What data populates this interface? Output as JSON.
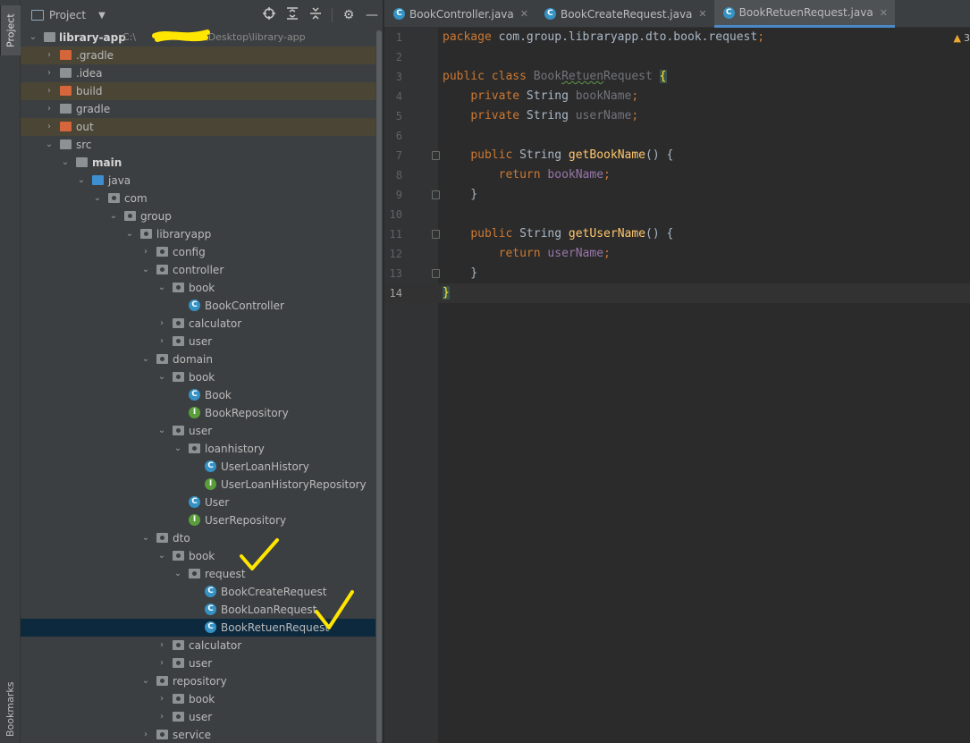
{
  "toolstrip": {
    "project_label": "Project",
    "bookmarks_label": "Bookmarks"
  },
  "project_panel": {
    "title": "Project",
    "tools": [
      "crosshair-icon",
      "expand-icon",
      "collapse-icon",
      "gear-icon",
      "minimize-icon"
    ],
    "root": {
      "name": "library-app",
      "path_prefix": "C:\\",
      "path_suffix": "\\Desktop\\library-app"
    },
    "nodes": [
      {
        "label": ".gradle",
        "icon": "folder-orange",
        "excluded": true,
        "collapsed": true
      },
      {
        "label": ".idea",
        "icon": "folder",
        "excluded": false,
        "collapsed": true
      },
      {
        "label": "build",
        "icon": "folder-orange",
        "excluded": true,
        "collapsed": true
      },
      {
        "label": "gradle",
        "icon": "folder",
        "excluded": false,
        "collapsed": true
      },
      {
        "label": "out",
        "icon": "folder-orange",
        "excluded": true,
        "collapsed": true
      },
      {
        "label": "src",
        "icon": "folder",
        "expanded": true
      },
      {
        "label": "main",
        "icon": "folder",
        "expanded": true
      },
      {
        "label": "java",
        "icon": "folder-blue",
        "expanded": true
      },
      {
        "label": "com",
        "icon": "package",
        "expanded": true
      },
      {
        "label": "group",
        "icon": "package",
        "expanded": true
      },
      {
        "label": "libraryapp",
        "icon": "package",
        "expanded": true
      },
      {
        "label": "config",
        "icon": "package",
        "collapsed": true
      },
      {
        "label": "controller",
        "icon": "package",
        "expanded": true
      },
      {
        "label": "book",
        "icon": "package",
        "expanded": true
      },
      {
        "label": "BookController",
        "icon": "class"
      },
      {
        "label": "calculator",
        "icon": "package",
        "collapsed": true
      },
      {
        "label": "user",
        "icon": "package",
        "collapsed": true
      },
      {
        "label": "domain",
        "icon": "package",
        "expanded": true
      },
      {
        "label": "book",
        "icon": "package",
        "expanded": true
      },
      {
        "label": "Book",
        "icon": "class"
      },
      {
        "label": "BookRepository",
        "icon": "interface"
      },
      {
        "label": "user",
        "icon": "package",
        "expanded": true
      },
      {
        "label": "loanhistory",
        "icon": "package",
        "expanded": true
      },
      {
        "label": "UserLoanHistory",
        "icon": "class"
      },
      {
        "label": "UserLoanHistoryRepository",
        "icon": "interface"
      },
      {
        "label": "User",
        "icon": "class"
      },
      {
        "label": "UserRepository",
        "icon": "interface"
      },
      {
        "label": "dto",
        "icon": "package",
        "expanded": true
      },
      {
        "label": "book",
        "icon": "package",
        "expanded": true
      },
      {
        "label": "request",
        "icon": "package",
        "expanded": true
      },
      {
        "label": "BookCreateRequest",
        "icon": "class"
      },
      {
        "label": "BookLoanRequest",
        "icon": "class"
      },
      {
        "label": "BookRetuenRequest",
        "icon": "class",
        "selected": true
      },
      {
        "label": "calculator",
        "icon": "package",
        "collapsed": true
      },
      {
        "label": "user",
        "icon": "package",
        "collapsed": true
      },
      {
        "label": "repository",
        "icon": "package",
        "expanded": true
      },
      {
        "label": "book",
        "icon": "package",
        "collapsed": true
      },
      {
        "label": "user",
        "icon": "package",
        "collapsed": true
      },
      {
        "label": "service",
        "icon": "package",
        "collapsed": true
      }
    ]
  },
  "editor": {
    "tabs": [
      {
        "label": "BookController.java",
        "active": false
      },
      {
        "label": "BookCreateRequest.java",
        "active": false
      },
      {
        "label": "BookRetuenRequest.java",
        "active": true
      }
    ],
    "warning_count": "3",
    "current_line": 14,
    "lines": [
      "package com.group.libraryapp.dto.book.request;",
      "",
      "public class BookRetuenRequest {",
      "    private String bookName;",
      "    private String userName;",
      "",
      "    public String getBookName() {",
      "        return bookName;",
      "    }",
      "",
      "    public String getUserName() {",
      "        return userName;",
      "    }",
      "}"
    ]
  },
  "annotations": {
    "checkmark_color": "#ffe600",
    "redaction_color": "#ffe600"
  }
}
